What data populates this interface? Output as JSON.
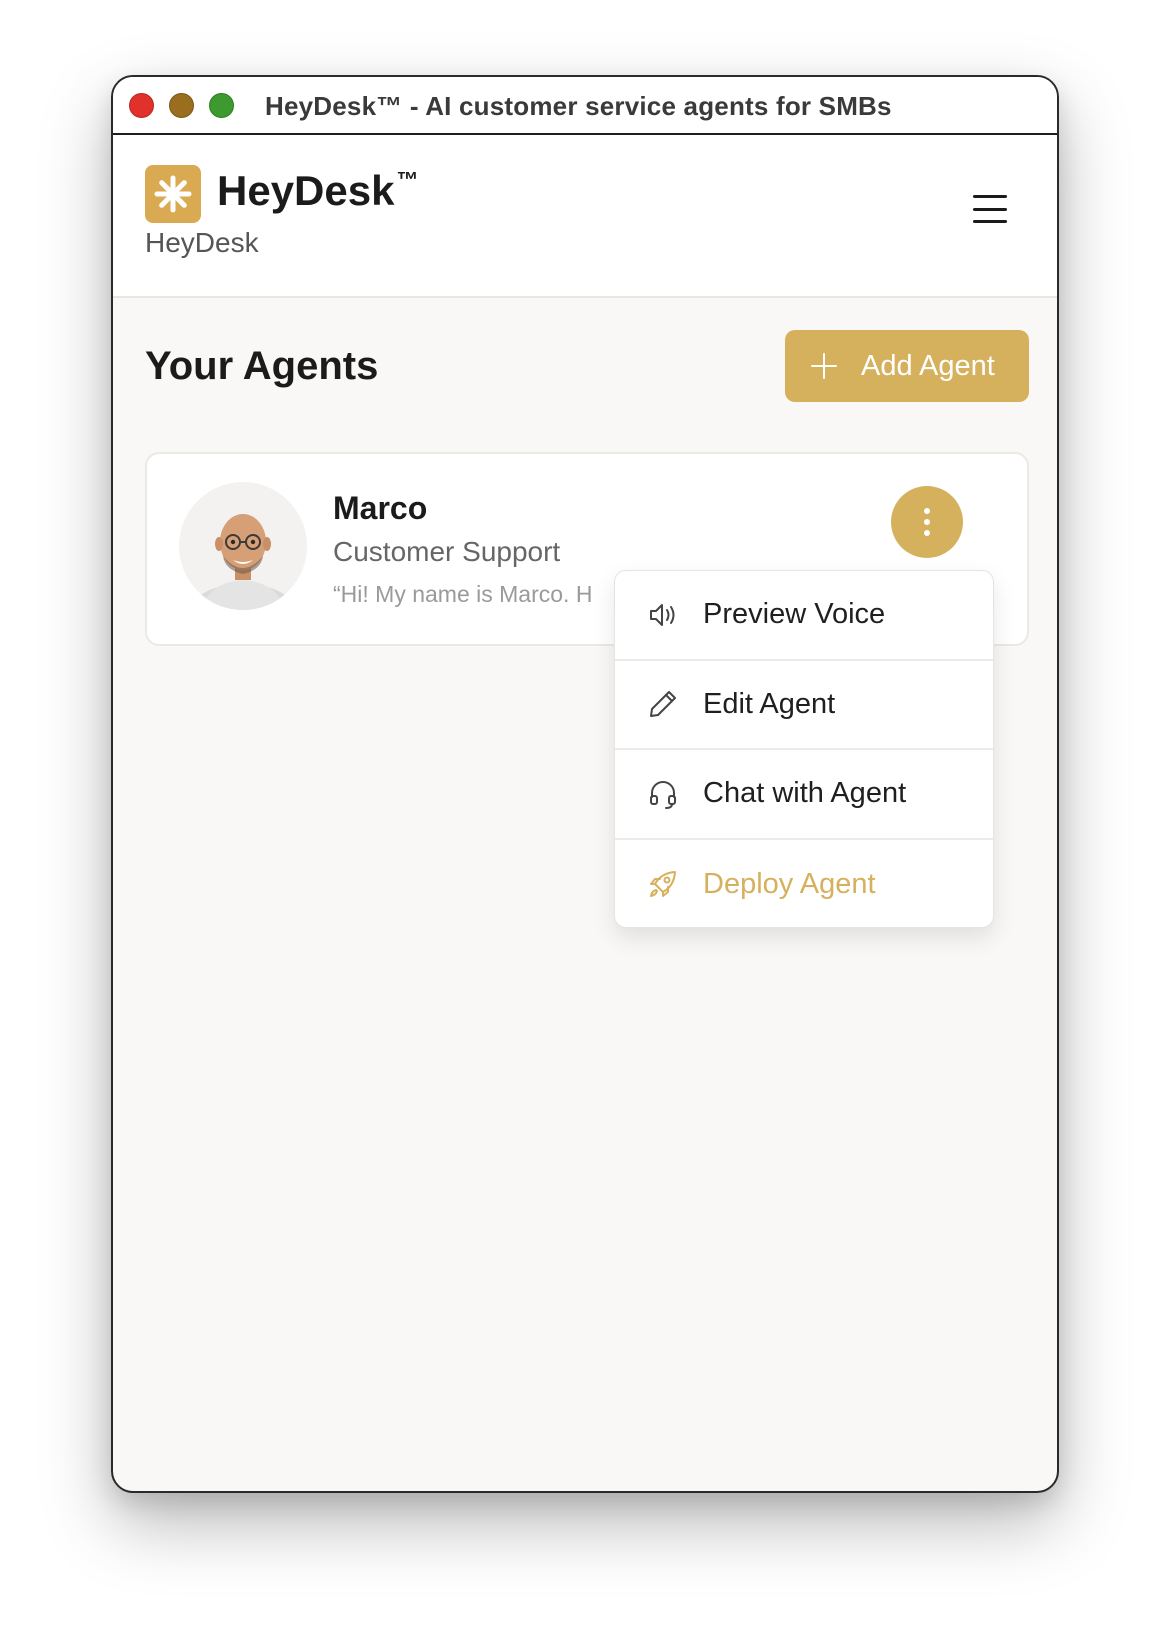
{
  "window": {
    "title": "HeyDesk™ - AI customer service agents for SMBs"
  },
  "header": {
    "brand_name": "HeyDesk",
    "brand_tm": "™",
    "brand_subtitle": "HeyDesk",
    "logo_icon": "asterisk-icon",
    "menu_icon": "hamburger-menu-icon"
  },
  "main": {
    "title": "Your Agents",
    "add_button_label": "Add Agent"
  },
  "agents": [
    {
      "name": "Marco",
      "role": "Customer Support",
      "greeting": "“Hi! My name is Marco. H"
    }
  ],
  "context_menu": {
    "items": [
      {
        "label": "Preview Voice",
        "icon": "speaker-icon"
      },
      {
        "label": "Edit Agent",
        "icon": "pencil-icon"
      },
      {
        "label": "Chat with Agent",
        "icon": "headphones-icon"
      },
      {
        "label": "Deploy Agent",
        "icon": "rocket-icon"
      }
    ]
  },
  "colors": {
    "accent": "#d6b15d",
    "logo": "#d9aa52",
    "close": "#e0322b",
    "minimize": "#9a6e1f",
    "maximize": "#3d9a2e"
  }
}
